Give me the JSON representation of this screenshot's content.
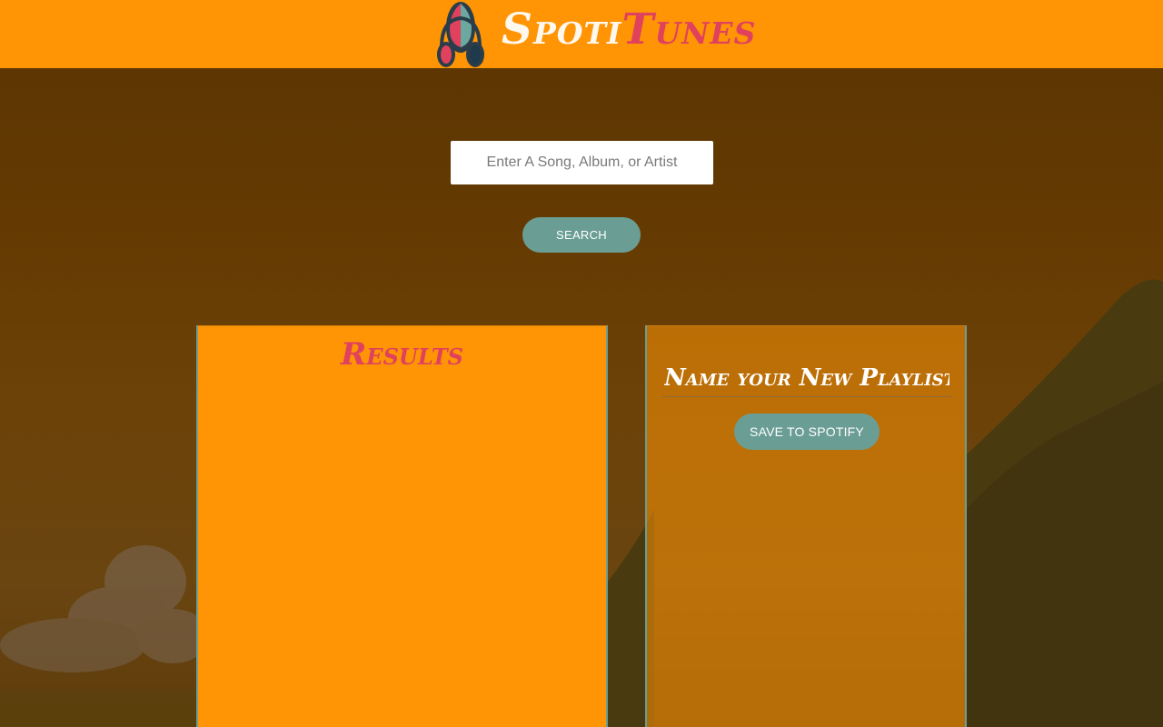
{
  "header": {
    "logo_icon": "headphones-icon",
    "title_part_a": "Spoti",
    "title_part_b": "Tunes",
    "background_color": "#ff9505",
    "accent_color": "#e0415c"
  },
  "search": {
    "placeholder": "Enter A Song, Album, or Artist",
    "value": "",
    "button_label": "SEARCH",
    "button_color": "#6a9e94"
  },
  "results": {
    "title": "Results",
    "items": []
  },
  "playlist": {
    "name_placeholder": "Name your New Playlist",
    "name_value": "",
    "save_label": "SAVE TO SPOTIFY",
    "tracks": []
  }
}
